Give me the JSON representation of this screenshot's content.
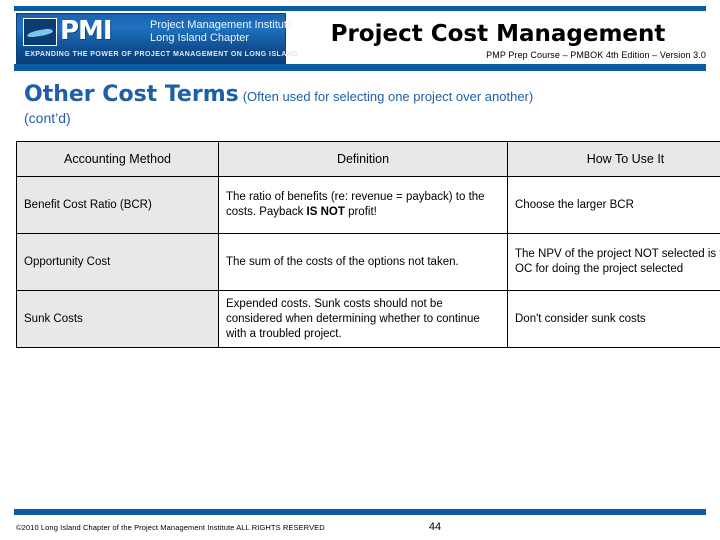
{
  "header": {
    "logo": {
      "mark_text": "PMI",
      "institute_line1": "Project Management Institute",
      "institute_line2": "Long Island Chapter",
      "tagline": "EXPANDING THE POWER OF PROJECT MANAGEMENT ON LONG ISLAND"
    },
    "title": "Project Cost Management",
    "subtitle": "PMP Prep Course – PMBOK 4th Edition – Version 3.0",
    "accent_color": "#0b5ba1"
  },
  "section": {
    "heading_main": "Other Cost Terms",
    "heading_parenthetical": "(Often used for selecting one project over another)",
    "heading_continued": "(cont’d)",
    "heading_color": "#1f5fa9"
  },
  "table": {
    "columns": [
      "Accounting Method",
      "Definition",
      "How To Use It"
    ],
    "rows": [
      {
        "method": "Benefit Cost Ratio (BCR)",
        "definition_pre": "The ratio of benefits (re: revenue = payback) to the costs.  Payback ",
        "definition_bold": "IS NOT",
        "definition_post": " profit!",
        "how_to_use": "Choose the larger BCR"
      },
      {
        "method": "Opportunity Cost",
        "definition_pre": "The sum of the costs of the options not taken.",
        "definition_bold": "",
        "definition_post": "",
        "how_to_use": "The NPV of the project NOT selected is the OC for doing the project selected"
      },
      {
        "method": "Sunk Costs",
        "definition_pre": "Expended costs.  Sunk costs should not be considered when determining whether to continue with a troubled project.",
        "definition_bold": "",
        "definition_post": "",
        "how_to_use": "Don't consider sunk costs"
      }
    ]
  },
  "footer": {
    "copyright": "©2010 Long Island Chapter of the Project Management Institute  ALL RIGHTS RESERVED",
    "page_number": "44"
  }
}
